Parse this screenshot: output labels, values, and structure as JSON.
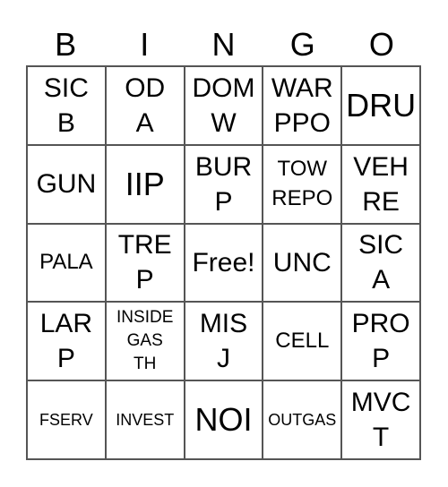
{
  "header": [
    "B",
    "I",
    "N",
    "G",
    "O"
  ],
  "cells": [
    [
      {
        "text": "SIC\nB",
        "size": "l"
      },
      {
        "text": "OD\nA",
        "size": "l"
      },
      {
        "text": "DOM\nW",
        "size": "l"
      },
      {
        "text": "WAR\nPPO",
        "size": "l"
      },
      {
        "text": "DRU",
        "size": "xl"
      }
    ],
    [
      {
        "text": "GUN",
        "size": "l"
      },
      {
        "text": "IIP",
        "size": "xl"
      },
      {
        "text": "BUR\nP",
        "size": "l"
      },
      {
        "text": "TOW\nREPO",
        "size": "m"
      },
      {
        "text": "VEH\nRE",
        "size": "l"
      }
    ],
    [
      {
        "text": "PALA",
        "size": "m"
      },
      {
        "text": "TRE\nP",
        "size": "l"
      },
      {
        "text": "Free!",
        "size": "l"
      },
      {
        "text": "UNC",
        "size": "l"
      },
      {
        "text": "SIC\nA",
        "size": "l"
      }
    ],
    [
      {
        "text": "LAR\nP",
        "size": "l"
      },
      {
        "text": "INSIDE\nGAS\nTH",
        "size": "s"
      },
      {
        "text": "MIS\nJ",
        "size": "l"
      },
      {
        "text": "CELL",
        "size": "m"
      },
      {
        "text": "PRO\nP",
        "size": "l"
      }
    ],
    [
      {
        "text": "FSERV",
        "size": "xs"
      },
      {
        "text": "INVEST",
        "size": "xs"
      },
      {
        "text": "NOI",
        "size": "xl"
      },
      {
        "text": "OUTGAS",
        "size": "xs"
      },
      {
        "text": "MVC\nT",
        "size": "l"
      }
    ]
  ]
}
